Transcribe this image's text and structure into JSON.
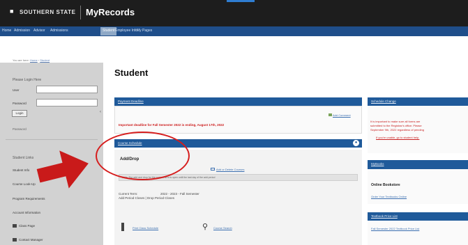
{
  "header": {
    "school": "SOUTHERN STATE",
    "app_title": "MyRecords"
  },
  "nav": {
    "items": [
      {
        "label": "Home"
      },
      {
        "label": "Admission"
      },
      {
        "label": "Advisor"
      },
      {
        "label": "Admissions"
      },
      {
        "label": "Student"
      },
      {
        "label": "Employee Info"
      },
      {
        "label": "My Pages"
      }
    ],
    "active_index": 4
  },
  "breadcrumb": {
    "prefix": "You are here:",
    "home": "Home",
    "current": "Student"
  },
  "sidebar": {
    "login_title": "Please Login Here",
    "user_label": "User",
    "password_label": "Password",
    "login_button": "Login",
    "password_link": "Password",
    "section_title": "Student Links",
    "links": [
      "Student Info",
      "Course Look-Up",
      "Program Requirements",
      "Account Information",
      "Class Page",
      "Contact Manager"
    ]
  },
  "main": {
    "page_title": "Student",
    "payment": {
      "header": "Payment Deadline",
      "add_comment": "Add Comment",
      "deadline_text": "Important deadline for Fall Semester 2022 is ending, August 17th, 2022"
    },
    "schedule": {
      "header": "Course Schedule",
      "add_drop": "Add/Drop",
      "add_delete_link": "Add or Delete Courses",
      "note": "Note: The add and drop for the current term is open until the last day of the add period",
      "note_bold": "Note:",
      "current_term_label": "Current Term:",
      "current_term_value": "2022 - 2023 - Fall Semester",
      "term_sub": "Add Period Closes | Drop Period Closes",
      "print_link": "Print Class Schedule",
      "search_link": "Course Search"
    }
  },
  "right": {
    "schedule_change": {
      "header": "Schedule Change",
      "lines": [
        "It is important to make sure all forms are",
        "submitted to the Registrar's office. Please",
        "September 9th, 2022 regardless of pending"
      ],
      "link": "If you're unable, go to student help."
    },
    "my_books": {
      "header": "MyBooks",
      "online_bookstore": "Online Bookstore",
      "link": "Order Your Textbooks Online"
    },
    "textbook": {
      "header": "Textbook Price List",
      "link": "Fall Semester 2022 Textbook Price List"
    }
  },
  "colors": {
    "header_bg": "#1d1d1d",
    "nav_bg": "#1f4e8a",
    "panel_bar": "#1f5a9a",
    "alert_red": "#cc1b1b",
    "highlight_red": "#d61d1d"
  }
}
